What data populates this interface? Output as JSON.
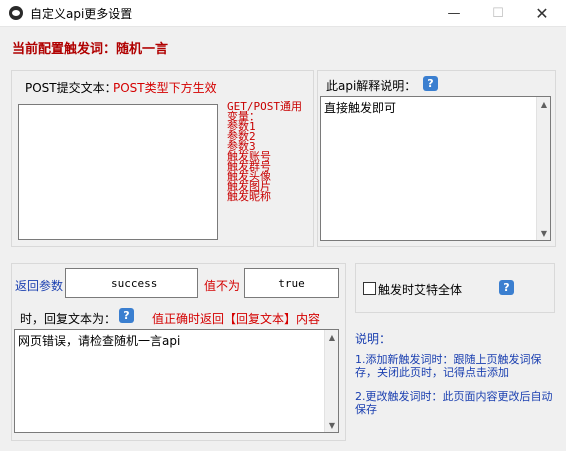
{
  "window": {
    "title": "自定义api更多设置",
    "minimize_glyph": "—",
    "maximize_glyph": "☐",
    "close_glyph": "✕"
  },
  "current_trigger": "当前配置触发词：随机一言",
  "post": {
    "label": "POST提交文本：",
    "note": "POST类型下方生效",
    "value": ""
  },
  "vars": {
    "title": "GET/POST通用",
    "subtitle": "变量：",
    "items": [
      "参数1",
      "参数2",
      "参数3",
      "触发账号",
      "触发群号",
      "触发头像",
      "触发图片",
      "触发昵称"
    ]
  },
  "explain": {
    "label": "此api解释说明：",
    "value": "直接触发即可"
  },
  "reply": {
    "return_param_label": "返回参数",
    "return_param_value": "success",
    "not_equal_label": "值不为",
    "not_equal_value": "true",
    "reply_text_label": "时，回复文本为：",
    "hint": "值正确时返回【回复文本】内容",
    "reply_text_value": "网页错误，请检查随机一言api"
  },
  "options": {
    "trigger_at_all_label": "触发时艾特全体",
    "trigger_at_all_checked": false
  },
  "help": {
    "title": "说明：",
    "item1": "1.添加新触发词时：跟随上页触发词保存，关闭此页时，记得点击添加",
    "item2": "2.更改触发词时：此页面内容更改后自动保存"
  },
  "colors": {
    "accent_red": "#b00000",
    "label_blue": "#1a3fb0",
    "help_icon": "#3b7fd0"
  }
}
